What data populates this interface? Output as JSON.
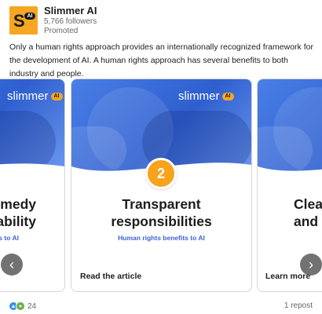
{
  "header": {
    "logo_letter": "S",
    "logo_badge": "AI",
    "company": "Slimmer AI",
    "followers": "5,766 followers",
    "promoted": "Promoted"
  },
  "post": {
    "text": "Only a human rights approach provides an internationally recognized framework for the development of AI. A human rights approach has several benefits to both industry and people."
  },
  "carousel": {
    "brand": "slimmer",
    "brand_badge": "AI",
    "cards": [
      {
        "title": "Remedy\navailability",
        "subtitle": "Human rights benefits to AI"
      },
      {
        "number": "2",
        "title": "Transparent\nresponsibilities",
        "subtitle": "Human rights benefits to AI",
        "cta": "Read the article"
      },
      {
        "title": "Clea\nand",
        "cta": "Learn more"
      }
    ],
    "prev_icon": "chevron-left-icon",
    "next_icon": "chevron-right-icon"
  },
  "footer": {
    "reaction_count": "24",
    "reposts": "1 repost"
  },
  "colors": {
    "brand_orange": "#f5a623",
    "card_blue": "#3e63d6",
    "bg": "#ffffff"
  }
}
